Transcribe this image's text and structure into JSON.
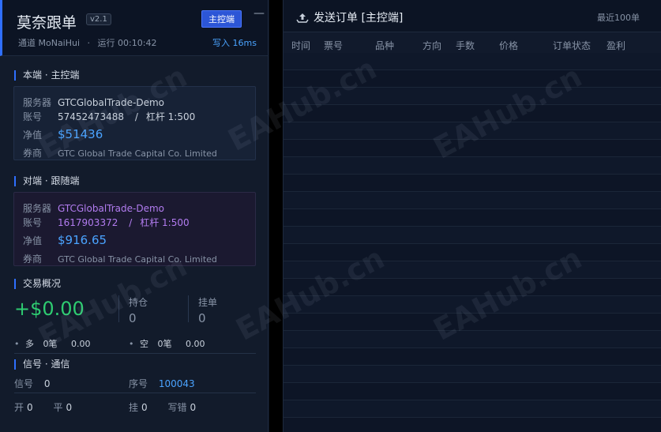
{
  "header": {
    "title": "莫奈跟单",
    "version": "v2.1",
    "role_button": "主控端",
    "minimize": "—",
    "channel": "通道 MoNaiHui",
    "separator": "·",
    "runtime": "运行 00:10:42",
    "write_info": "写入 16ms"
  },
  "local": {
    "section_title": "本端 · 主控端",
    "server_label": "服务器",
    "server": "GTCGlobalTrade-Demo",
    "account_label": "账号",
    "account": "57452473488",
    "slash": "/",
    "leverage": "杠杆 1:500",
    "equity_label": "净值",
    "equity": "$51436",
    "broker_label": "券商",
    "broker": "GTC Global Trade Capital Co. Limited"
  },
  "remote": {
    "section_title": "对端 · 跟随端",
    "server_label": "服务器",
    "server": "GTCGlobalTrade-Demo",
    "account_label": "账号",
    "account": "1617903372",
    "slash": "/",
    "leverage": "杠杆 1:500",
    "equity_label": "净值",
    "equity": "$916.65",
    "broker_label": "券商",
    "broker": "GTC Global Trade Capital Co. Limited"
  },
  "trade": {
    "section_title": "交易概况",
    "pnl": "+$0.00",
    "positions_label": "持仓",
    "positions": "0",
    "pending_label": "挂单",
    "pending": "0",
    "bullet": "•",
    "long_label": "多",
    "long_count": "0笔",
    "long_value": "0.00",
    "short_label": "空",
    "short_count": "0笔",
    "short_value": "0.00"
  },
  "signal": {
    "section_title": "信号 · 通信",
    "signal_label": "信号",
    "signal_value": "0",
    "seq_label": "序号",
    "seq_value": "100043",
    "open_label": "开",
    "open_value": "0",
    "close_label": "平",
    "close_value": "0",
    "hang_label": "挂",
    "hang_value": "0",
    "write_err_label": "写错",
    "write_err_value": "0"
  },
  "orders": {
    "title": "发送订单 [主控端]",
    "recent": "最近100单",
    "columns": [
      "时间",
      "票号",
      "品种",
      "方向",
      "手数",
      "价格",
      "订单状态",
      "盈利"
    ]
  },
  "watermark": "EAHub.cn",
  "colors": {
    "accent": "#2f6fff",
    "profit": "#2ecc71",
    "equity": "#4aa3ff",
    "remote_text": "#b27cf0"
  }
}
